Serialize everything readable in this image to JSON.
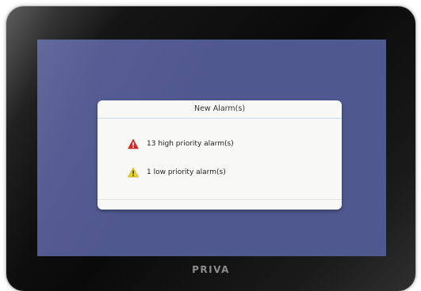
{
  "device": {
    "brand": "PRIVA"
  },
  "dialog": {
    "title": "New Alarm(s)",
    "alarms": [
      {
        "icon": "warning-triangle-red-icon",
        "color": "#d8262b",
        "text": "13 high priority alarm(s)"
      },
      {
        "icon": "warning-triangle-yellow-icon",
        "color": "#e8d21d",
        "text": "1 low priority alarm(s)"
      }
    ]
  },
  "colors": {
    "screen_background": "#505890",
    "dialog_background": "#f8f8f6",
    "header_divider": "#c9dce6",
    "bezel": "#0a0a0a"
  }
}
